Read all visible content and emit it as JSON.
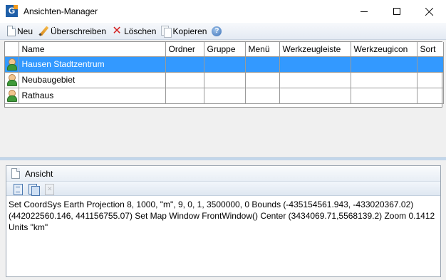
{
  "window": {
    "title": "Ansichten-Manager"
  },
  "toolbar": {
    "new_label": "Neu",
    "overwrite_label": "Überschreiben",
    "delete_label": "Löschen",
    "copy_label": "Kopieren"
  },
  "grid": {
    "columns": [
      "Name",
      "Ordner",
      "Gruppe",
      "Menü",
      "Werkzeugleiste",
      "Werkzeugicon",
      "Sort"
    ],
    "rows": [
      {
        "name": "Hausen Stadtzentrum",
        "selected": true
      },
      {
        "name": "Neubaugebiet",
        "selected": false
      },
      {
        "name": "Rathaus",
        "selected": false
      }
    ]
  },
  "panel": {
    "title": "Ansicht",
    "text": "Set CoordSys Earth Projection 8, 1000, \"m\", 9, 0, 1, 3500000, 0 Bounds (-435154561.943, -433020367.02) (442022560.146, 441156755.07) Set Map Window FrontWindow() Center (3434069.71,5568139.2) Zoom 0.1412 Units \"km\""
  },
  "colors": {
    "selection": "#3399ff",
    "splitter": "#c3d6ea"
  }
}
